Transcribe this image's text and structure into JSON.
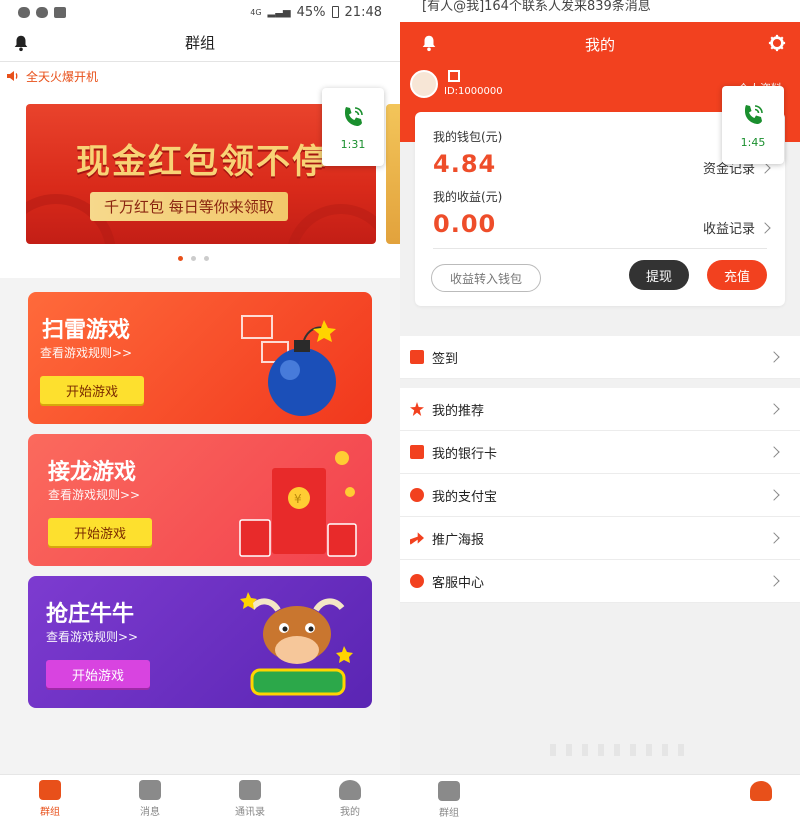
{
  "left": {
    "status": {
      "battery": "45%",
      "time": "21:48",
      "network": "4G"
    },
    "title": "群组",
    "notice": "全天火爆开机",
    "banner": {
      "title": "现金红包领不停",
      "subtitle": "千万红包 每日等你来领取"
    },
    "call_timer": "1:31",
    "games": [
      {
        "title": "扫雷游戏",
        "rules": "查看游戏规则>>",
        "button": "开始游戏"
      },
      {
        "title": "接龙游戏",
        "rules": "查看游戏规则>>",
        "button": "开始游戏"
      },
      {
        "title": "抢庄牛牛",
        "rules": "查看游戏规则>>",
        "button": "开始游戏"
      }
    ],
    "tabs": [
      {
        "label": "群组",
        "active": true
      },
      {
        "label": "消息",
        "active": false
      },
      {
        "label": "通讯录",
        "active": false
      },
      {
        "label": "我的",
        "active": false
      }
    ]
  },
  "right": {
    "top_note": "[有人@我]164个联系人发来839条消息",
    "title": "我的",
    "user_id": "ID:1000000",
    "profile_link": "个人资料",
    "call_timer": "1:45",
    "wallet": {
      "wallet_label": "我的钱包(元)",
      "wallet_value": "4.84",
      "wallet_link": "资金记录",
      "earnings_label": "我的收益(元)",
      "earnings_value": "0.00",
      "earnings_link": "收益记录",
      "transfer": "收益转入钱包",
      "withdraw": "提现",
      "recharge": "充值"
    },
    "menu_group1": [
      {
        "label": "签到",
        "icon": "checkin-icon"
      }
    ],
    "menu_group2": [
      {
        "label": "我的推荐",
        "icon": "star-icon"
      },
      {
        "label": "我的银行卡",
        "icon": "bank-card-icon"
      },
      {
        "label": "我的支付宝",
        "icon": "alipay-icon"
      },
      {
        "label": "推广海报",
        "icon": "share-icon"
      },
      {
        "label": "客服中心",
        "icon": "chat-icon"
      }
    ],
    "bottom_tab": "群组"
  },
  "colors": {
    "accent": "#f2411f",
    "button_yellow": "#fde02e",
    "call_green": "#1a8f2e"
  }
}
